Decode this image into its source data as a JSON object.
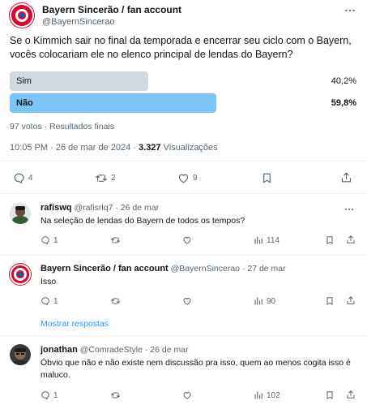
{
  "tweet": {
    "author_name": "Bayern Sincerão / fan account",
    "author_handle": "@BayernSincerao",
    "text": "Se o Kimmich sair no final da temporada e encerrar seu ciclo com o Bayern, vocês colocariam ele no elenco principal de lendas do Bayern?",
    "poll": {
      "options": [
        {
          "label": "Sim",
          "percent": "40,2%",
          "fraction": 0.402,
          "winner": false
        },
        {
          "label": "Não",
          "percent": "59,8%",
          "fraction": 0.598,
          "winner": true
        }
      ],
      "votes": "97 votos",
      "separator": "·",
      "status": "Resultados finais"
    },
    "time": "10:05 PM · 26 de mar de 2024",
    "separator": "·",
    "views_count": "3.327",
    "views_label": "Visualizações",
    "actions": {
      "replies": "4",
      "retweets": "2",
      "likes": "9"
    }
  },
  "replies": [
    {
      "name": "rafiswq",
      "handle": "@rafisrlq7",
      "sep": "·",
      "date": "26 de mar",
      "text": "Na seleção de lendas do Bayern de todos os tempos?",
      "replies": "1",
      "views": "114"
    },
    {
      "name": "Bayern Sincerão / fan account",
      "handle": "@BayernSincerao",
      "sep": "·",
      "date": "27 de mar",
      "text": "Isso",
      "replies": "1",
      "views": "90"
    },
    {
      "show_more": "Mostrar respostas"
    },
    {
      "name": "jonathan",
      "handle": "@ComradeStyle",
      "sep": "·",
      "date": "26 de mar",
      "text": "Óbvio que não e não existe nem discussão pra isso, quem ao menos cogita isso é maluco.",
      "replies": "1",
      "views": "102"
    }
  ],
  "colors": {
    "poll_winner": "#7cc5f6",
    "poll_other": "#cfd9de",
    "accent": "#1d9bf0",
    "bayern_red": "#dc052d"
  }
}
